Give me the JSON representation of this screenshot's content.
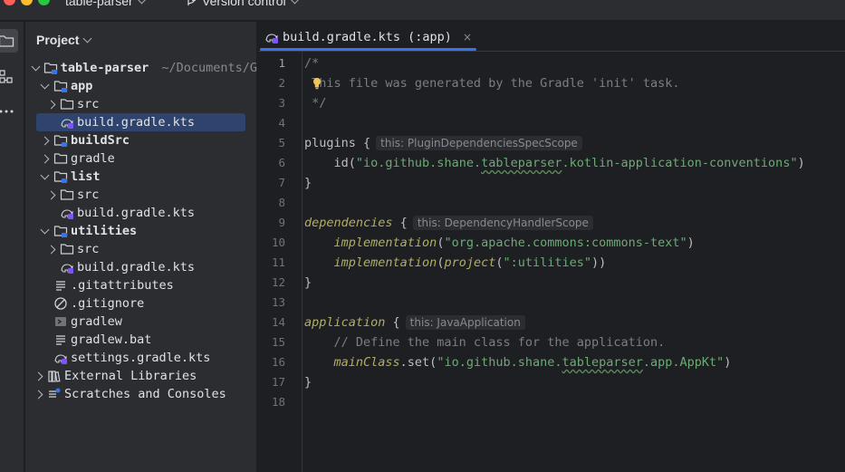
{
  "titlebar": {
    "project_name": "table-parser",
    "vcs_label": "Version control"
  },
  "toolstrip": {
    "icons": [
      "folder-icon",
      "structure-icon",
      "more-icon"
    ]
  },
  "project_panel": {
    "title": "Project",
    "tree": [
      {
        "label": "table-parser",
        "path": "~/Documents/G",
        "bold": true,
        "arrow": "down",
        "icon": "module-folder-icon",
        "depth": 0
      },
      {
        "label": "app",
        "bold": true,
        "arrow": "down",
        "icon": "module-folder-icon",
        "depth": 1
      },
      {
        "label": "src",
        "bold": false,
        "arrow": "right",
        "icon": "folder-icon",
        "depth": 2
      },
      {
        "label": "build.gradle.kts",
        "bold": false,
        "arrow": "none",
        "icon": "gradle-icon",
        "depth": 2,
        "selected": true
      },
      {
        "label": "buildSrc",
        "bold": true,
        "arrow": "right",
        "icon": "module-folder-icon",
        "depth": 1
      },
      {
        "label": "gradle",
        "bold": false,
        "arrow": "right",
        "icon": "folder-icon",
        "depth": 1
      },
      {
        "label": "list",
        "bold": true,
        "arrow": "down",
        "icon": "module-folder-icon",
        "depth": 1
      },
      {
        "label": "src",
        "bold": false,
        "arrow": "right",
        "icon": "folder-icon",
        "depth": 2
      },
      {
        "label": "build.gradle.kts",
        "bold": false,
        "arrow": "none",
        "icon": "gradle-icon",
        "depth": 2
      },
      {
        "label": "utilities",
        "bold": true,
        "arrow": "down",
        "icon": "module-folder-icon",
        "depth": 1
      },
      {
        "label": "src",
        "bold": false,
        "arrow": "right",
        "icon": "folder-icon",
        "depth": 2
      },
      {
        "label": "build.gradle.kts",
        "bold": false,
        "arrow": "none",
        "icon": "gradle-icon",
        "depth": 2
      },
      {
        "label": ".gitattributes",
        "bold": false,
        "arrow": "none",
        "icon": "text-file-icon",
        "depth": 1
      },
      {
        "label": ".gitignore",
        "bold": false,
        "arrow": "none",
        "icon": "ignore-file-icon",
        "depth": 1
      },
      {
        "label": "gradlew",
        "bold": false,
        "arrow": "none",
        "icon": "shell-script-icon",
        "depth": 1
      },
      {
        "label": "gradlew.bat",
        "bold": false,
        "arrow": "none",
        "icon": "text-file-icon",
        "depth": 1
      },
      {
        "label": "settings.gradle.kts",
        "bold": false,
        "arrow": "none",
        "icon": "gradle-icon",
        "depth": 1
      },
      {
        "label": "External Libraries",
        "bold": false,
        "arrow": "right",
        "icon": "library-icon",
        "depth": 0
      },
      {
        "label": "Scratches and Consoles",
        "bold": false,
        "arrow": "right",
        "icon": "scratches-icon",
        "depth": 0
      }
    ]
  },
  "editor": {
    "tab_label": "build.gradle.kts (:app)",
    "tab_close": "×",
    "current_line": 1,
    "lines": [
      [
        {
          "t": "/*",
          "c": "c-com"
        }
      ],
      [
        {
          "t": " This file was generated by the Gradle 'init' task.",
          "c": "c-com"
        }
      ],
      [
        {
          "t": " */",
          "c": "c-com"
        }
      ],
      [],
      [
        {
          "t": "plugins {"
        },
        {
          "t": "this: PluginDependenciesSpecScope",
          "c": "c-hint"
        }
      ],
      [
        {
          "t": "    id("
        },
        {
          "t": "\"io.github.shane.",
          "c": "c-str"
        },
        {
          "t": "tableparser",
          "c": "c-str squig"
        },
        {
          "t": ".kotlin-application-conventions\"",
          "c": "c-str"
        },
        {
          "t": ")"
        }
      ],
      [
        {
          "t": "}"
        }
      ],
      [],
      [
        {
          "t": "dependencies",
          "c": "c-ext"
        },
        {
          "t": " {"
        },
        {
          "t": "this: DependencyHandlerScope",
          "c": "c-hint"
        }
      ],
      [
        {
          "t": "    "
        },
        {
          "t": "implementation",
          "c": "c-ext"
        },
        {
          "t": "("
        },
        {
          "t": "\"org.apache.commons:commons-text\"",
          "c": "c-str"
        },
        {
          "t": ")"
        }
      ],
      [
        {
          "t": "    "
        },
        {
          "t": "implementation",
          "c": "c-ext"
        },
        {
          "t": "("
        },
        {
          "t": "project",
          "c": "c-ext"
        },
        {
          "t": "("
        },
        {
          "t": "\":utilities\"",
          "c": "c-str"
        },
        {
          "t": "))"
        }
      ],
      [
        {
          "t": "}"
        }
      ],
      [],
      [
        {
          "t": "application",
          "c": "c-ext"
        },
        {
          "t": " {"
        },
        {
          "t": "this: JavaApplication",
          "c": "c-hint"
        }
      ],
      [
        {
          "t": "    // Define the main class for the application.",
          "c": "c-com"
        }
      ],
      [
        {
          "t": "    "
        },
        {
          "t": "mainClass",
          "c": "c-ext"
        },
        {
          "t": ".set("
        },
        {
          "t": "\"io.github.shane.",
          "c": "c-str"
        },
        {
          "t": "tableparser",
          "c": "c-str squig"
        },
        {
          "t": ".app.AppKt\"",
          "c": "c-str"
        },
        {
          "t": ")"
        }
      ],
      [
        {
          "t": "}"
        }
      ],
      []
    ]
  }
}
